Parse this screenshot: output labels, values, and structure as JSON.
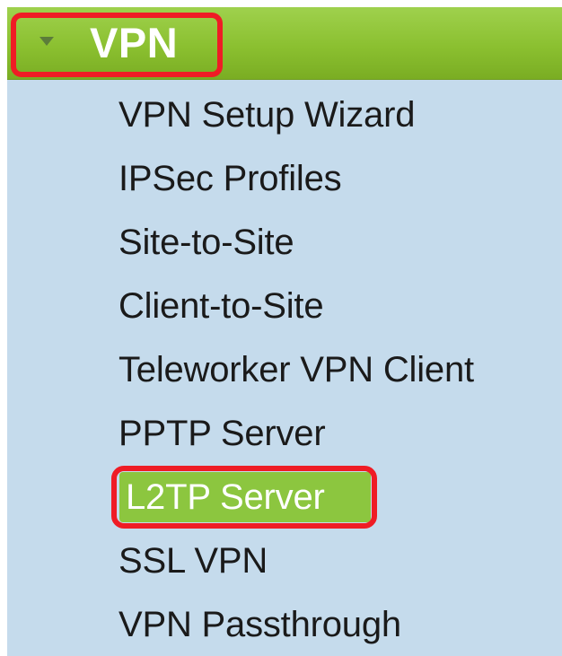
{
  "nav": {
    "section": {
      "label": "VPN",
      "expanded": true,
      "color": "#8cc63f"
    },
    "items": [
      {
        "label": "VPN Setup Wizard"
      },
      {
        "label": "IPSec Profiles"
      },
      {
        "label": "Site-to-Site"
      },
      {
        "label": "Client-to-Site"
      },
      {
        "label": "Teleworker VPN Client"
      },
      {
        "label": "PPTP Server"
      },
      {
        "label": "L2TP Server",
        "selected": true
      },
      {
        "label": "SSL VPN"
      },
      {
        "label": "VPN Passthrough"
      }
    ],
    "highlight_color": "#ef1c25",
    "selected_color": "#8cc63f",
    "background_color": "#c5dbec"
  }
}
